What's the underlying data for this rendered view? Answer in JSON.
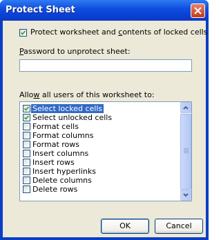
{
  "dialog": {
    "title": "Protect Sheet",
    "close_icon": "close-icon"
  },
  "protect_option": {
    "checked": true,
    "label_pre": "Protect worksheet and ",
    "label_u": "c",
    "label_post": "ontents of locked cells"
  },
  "password": {
    "label_u": "P",
    "label_rest": "assword to unprotect sheet:",
    "value": ""
  },
  "allow": {
    "label_pre": "Allo",
    "label_u": "w",
    "label_post": " all users of this worksheet to:",
    "items": [
      {
        "label": "Select locked cells",
        "checked": true,
        "selected": true
      },
      {
        "label": "Select unlocked cells",
        "checked": true,
        "selected": false
      },
      {
        "label": "Format cells",
        "checked": false,
        "selected": false
      },
      {
        "label": "Format columns",
        "checked": false,
        "selected": false
      },
      {
        "label": "Format rows",
        "checked": false,
        "selected": false
      },
      {
        "label": "Insert columns",
        "checked": false,
        "selected": false
      },
      {
        "label": "Insert rows",
        "checked": false,
        "selected": false
      },
      {
        "label": "Insert hyperlinks",
        "checked": false,
        "selected": false
      },
      {
        "label": "Delete columns",
        "checked": false,
        "selected": false
      },
      {
        "label": "Delete rows",
        "checked": false,
        "selected": false
      }
    ]
  },
  "buttons": {
    "ok": "OK",
    "cancel": "Cancel"
  }
}
